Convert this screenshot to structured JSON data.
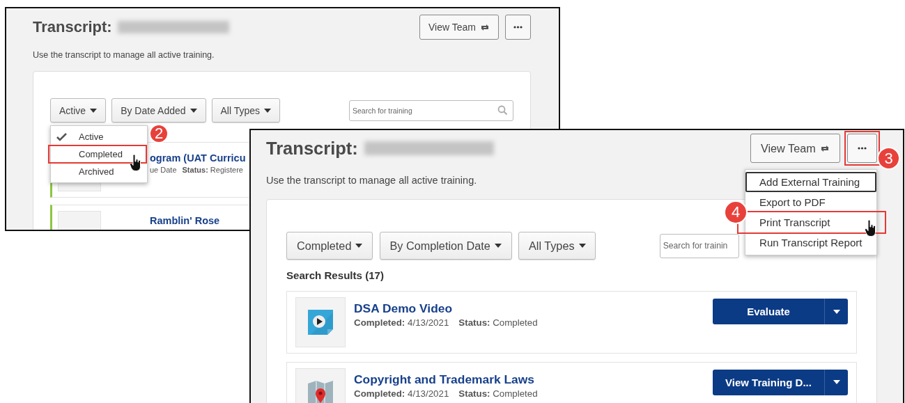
{
  "back_window": {
    "title": "Transcript:",
    "view_team_button": {
      "label": "View Team"
    },
    "more_button": {
      "highlighted": false
    },
    "subtitle": "Use the transcript to manage all active training.",
    "filters": [
      {
        "label": "Active"
      },
      {
        "label": "By Date Added"
      },
      {
        "label": "All Types"
      }
    ],
    "filter_menu": {
      "items": [
        {
          "label": "Active",
          "checked": true,
          "highlighted": false
        },
        {
          "label": "Completed",
          "checked": false,
          "highlighted": true
        },
        {
          "label": "Archived",
          "checked": false,
          "highlighted": false
        }
      ]
    },
    "search": {
      "placeholder": "Search for training"
    },
    "items": [
      {
        "kind": "blank",
        "title": "ogram (UAT Curricu",
        "meta": [
          "ue Date",
          "**Status:** Registere"
        ]
      },
      {
        "kind": "blank",
        "title": "Ramblin' Rose"
      }
    ]
  },
  "front_window": {
    "title": "Transcript:",
    "view_team_button": {
      "label": "View Team"
    },
    "more_button": {
      "highlighted": true
    },
    "subtitle": "Use the transcript to manage all active training.",
    "more_menu": {
      "items": [
        {
          "label": "Add External Training",
          "focused": true,
          "highlighted": false
        },
        {
          "label": "Export to PDF",
          "focused": false,
          "highlighted": false
        },
        {
          "label": "Print Transcript",
          "focused": false,
          "highlighted": true
        },
        {
          "label": "Run Transcript Report",
          "focused": false,
          "highlighted": false
        }
      ]
    },
    "filters": [
      {
        "label": "Completed"
      },
      {
        "label": "By Completion Date"
      },
      {
        "label": "All Types"
      }
    ],
    "search": {
      "placeholder": "Search for trainin"
    },
    "results_label": "Search Results (17)",
    "items": [
      {
        "kind": "video",
        "title": "DSA Demo Video",
        "meta": [
          "**Completed:** 4/13/2021",
          "**Status:** Completed"
        ],
        "action": "Evaluate"
      },
      {
        "kind": "map",
        "title": "Copyright and Trademark Laws",
        "meta": [
          "**Completed:** 4/13/2021",
          "**Status:** Completed"
        ],
        "action": "View Training D..."
      }
    ]
  },
  "annotations": [
    {
      "kind": "step",
      "label": "2"
    },
    {
      "kind": "cursor"
    },
    {
      "kind": "step",
      "label": "3"
    },
    {
      "kind": "step",
      "label": "4"
    },
    {
      "kind": "cursor"
    }
  ]
}
